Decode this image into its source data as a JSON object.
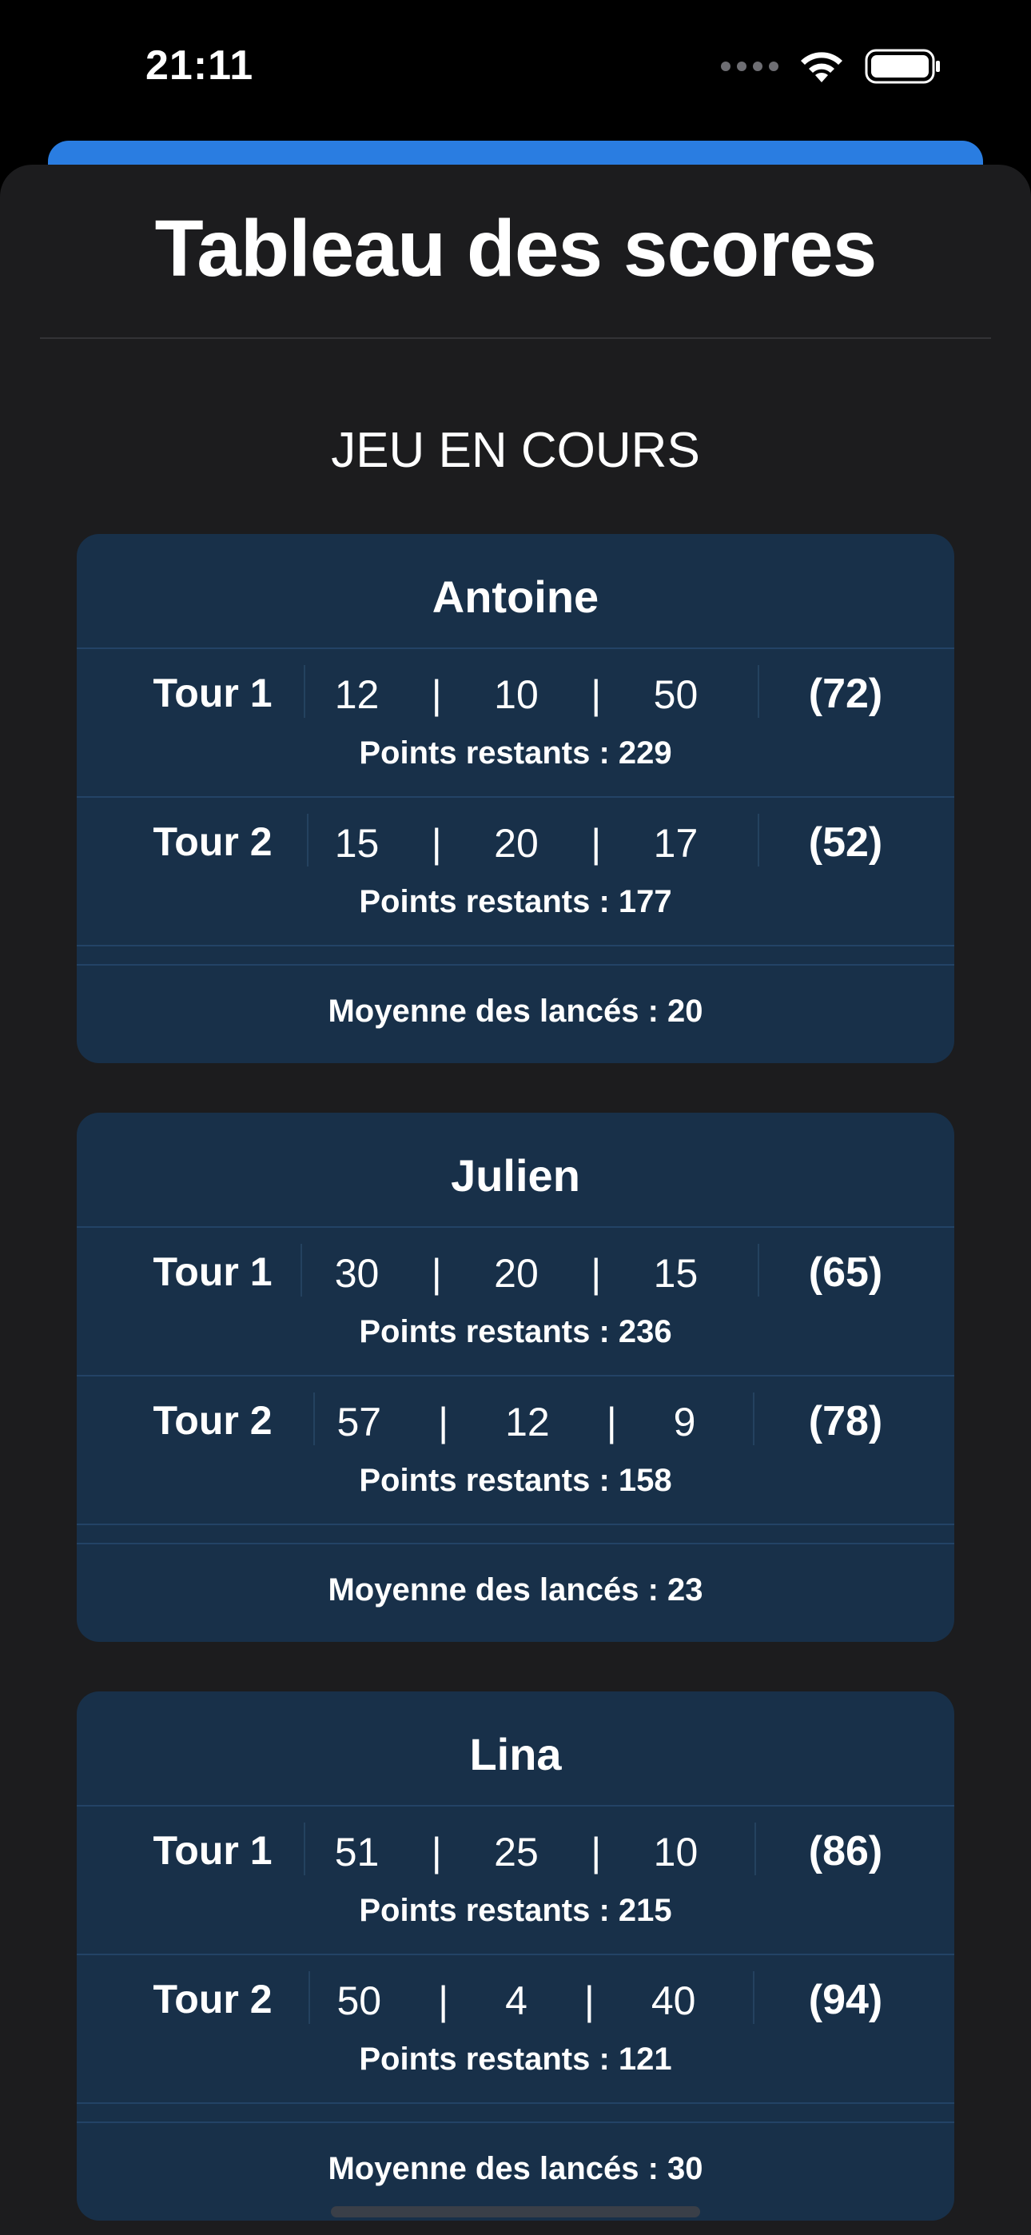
{
  "status_bar": {
    "time": "21:11"
  },
  "header": {
    "title": "Tableau des scores"
  },
  "section": {
    "title": "JEU EN COURS"
  },
  "players": [
    {
      "name": "Antoine",
      "rounds": [
        {
          "label": "Tour 1",
          "throws": [
            "12",
            "10",
            "50"
          ],
          "total": "(72)",
          "remaining": "Points restants : 229"
        },
        {
          "label": "Tour 2",
          "throws": [
            "15",
            "20",
            "17"
          ],
          "total": "(52)",
          "remaining": "Points restants : 177"
        }
      ],
      "average": "Moyenne des lancés : 20"
    },
    {
      "name": "Julien",
      "rounds": [
        {
          "label": "Tour 1",
          "throws": [
            "30",
            "20",
            "15"
          ],
          "total": "(65)",
          "remaining": "Points restants : 236"
        },
        {
          "label": "Tour 2",
          "throws": [
            "57",
            "12",
            "9"
          ],
          "total": "(78)",
          "remaining": "Points restants : 158"
        }
      ],
      "average": "Moyenne des lancés : 23"
    },
    {
      "name": "Lina",
      "rounds": [
        {
          "label": "Tour 1",
          "throws": [
            "51",
            "25",
            "10"
          ],
          "total": "(86)",
          "remaining": "Points restants : 215"
        },
        {
          "label": "Tour 2",
          "throws": [
            "50",
            "4",
            "40"
          ],
          "total": "(94)",
          "remaining": "Points restants : 121"
        }
      ],
      "average": "Moyenne des lancés : 30"
    }
  ],
  "separator": "|",
  "colors": {
    "background": "#000000",
    "sheet": "#1c1c1e",
    "card": "#183049",
    "accent_behind_sheet": "#2a7de1",
    "text": "#ffffff"
  },
  "icons": [
    "wifi-icon",
    "battery-icon",
    "cellular-signal-icon"
  ]
}
